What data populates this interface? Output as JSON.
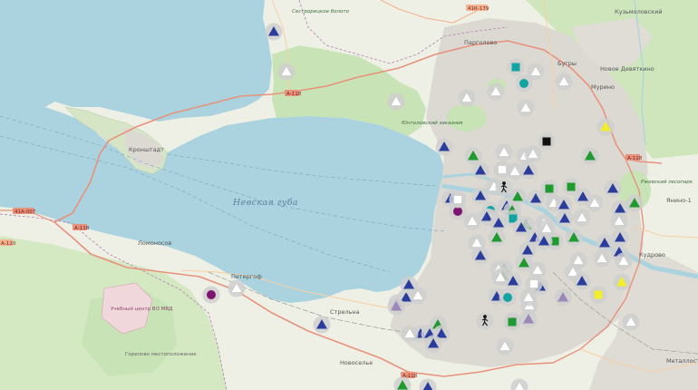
{
  "map": {
    "water_label": "Невская губа",
    "places": [
      {
        "name": "Парголово"
      },
      {
        "name": "Кронштадт"
      },
      {
        "name": "Ломоносов"
      },
      {
        "name": "Петергоф"
      },
      {
        "name": "Стрельна"
      },
      {
        "name": "Новоселье"
      },
      {
        "name": "Кудрово"
      },
      {
        "name": "Мурино"
      },
      {
        "name": "Новое Девяткино"
      },
      {
        "name": "Кузьмоловский"
      },
      {
        "name": "Янино-1"
      },
      {
        "name": "Металлострой"
      },
      {
        "name": "Бугры"
      }
    ],
    "parks": [
      {
        "name": "Юнтоловский заказник"
      },
      {
        "name": "Сестрорецкое болото"
      },
      {
        "name": "Ржевский лесопарк"
      }
    ],
    "roads": [
      {
        "name": "А-118"
      },
      {
        "name": "А-118"
      },
      {
        "name": "А-118"
      },
      {
        "name": "А-118"
      },
      {
        "name": "41К-179"
      },
      {
        "name": "41А-007"
      },
      {
        "name": "А-120"
      }
    ],
    "military": [
      {
        "name": "Учебный центр ВО МВД"
      }
    ],
    "cemeteries": [
      {
        "name": "Горелово местоположение"
      }
    ],
    "colors": {
      "sea": "#aad3df",
      "land": "#eef0e6",
      "forest": "#c8e3b5",
      "urban": "#dfdcd6",
      "road": "#e8927c",
      "marker_gray": "#cfcfcf",
      "blue": "#2a3d9c",
      "green": "#1f9a2e",
      "white": "#ffffff",
      "teal": "#12a3a3",
      "purple": "#7d1570",
      "lavender": "#9b87b8",
      "yellow": "#f2ee2a",
      "black": "#111111"
    }
  },
  "markers": [
    {
      "shape": "triangle",
      "color": "blue"
    },
    {
      "shape": "triangle",
      "color": "white"
    },
    {
      "shape": "square",
      "color": "teal"
    },
    {
      "shape": "triangle",
      "color": "white"
    },
    {
      "shape": "circle",
      "color": "teal"
    },
    {
      "shape": "triangle",
      "color": "white"
    },
    {
      "shape": "triangle",
      "color": "white"
    },
    {
      "shape": "triangle",
      "color": "white"
    },
    {
      "shape": "triangle",
      "color": "white"
    },
    {
      "shape": "triangle",
      "color": "white"
    },
    {
      "shape": "triangle",
      "color": "yellow"
    },
    {
      "shape": "square",
      "color": "black"
    },
    {
      "shape": "triangle",
      "color": "blue"
    },
    {
      "shape": "triangle",
      "color": "green"
    },
    {
      "shape": "triangle",
      "color": "white"
    },
    {
      "shape": "triangle",
      "color": "white"
    },
    {
      "shape": "triangle",
      "color": "white"
    },
    {
      "shape": "triangle",
      "color": "green"
    },
    {
      "shape": "square",
      "color": "white"
    },
    {
      "shape": "triangle",
      "color": "blue"
    },
    {
      "shape": "triangle",
      "color": "white"
    },
    {
      "shape": "triangle",
      "color": "blue"
    },
    {
      "shape": "triangle",
      "color": "white"
    },
    {
      "shape": "square",
      "color": "green"
    },
    {
      "shape": "triangle",
      "color": "blue"
    },
    {
      "shape": "triangle",
      "color": "blue"
    },
    {
      "shape": "circle",
      "color": "teal"
    },
    {
      "shape": "circle",
      "color": "purple"
    },
    {
      "shape": "triangle",
      "color": "green"
    },
    {
      "shape": "triangle",
      "color": "blue"
    },
    {
      "shape": "triangle",
      "color": "white"
    },
    {
      "shape": "triangle",
      "color": "blue"
    },
    {
      "shape": "triangle",
      "color": "white"
    },
    {
      "shape": "triangle",
      "color": "green"
    },
    {
      "shape": "triangle",
      "color": "blue"
    },
    {
      "shape": "triangle",
      "color": "blue"
    },
    {
      "shape": "square",
      "color": "green"
    },
    {
      "shape": "triangle",
      "color": "blue"
    },
    {
      "shape": "square",
      "color": "white"
    },
    {
      "shape": "triangle",
      "color": "white"
    },
    {
      "shape": "triangle",
      "color": "green"
    },
    {
      "shape": "triangle",
      "color": "blue"
    },
    {
      "shape": "triangle",
      "color": "white"
    },
    {
      "shape": "triangle",
      "color": "blue"
    },
    {
      "shape": "triangle",
      "color": "green"
    },
    {
      "shape": "triangle",
      "color": "white"
    },
    {
      "shape": "triangle",
      "color": "blue"
    },
    {
      "shape": "triangle",
      "color": "white"
    },
    {
      "shape": "square",
      "color": "teal"
    },
    {
      "shape": "triangle",
      "color": "green"
    },
    {
      "shape": "triangle",
      "color": "blue"
    },
    {
      "shape": "triangle",
      "color": "white"
    },
    {
      "shape": "triangle",
      "color": "blue"
    },
    {
      "shape": "triangle",
      "color": "green"
    },
    {
      "shape": "triangle",
      "color": "blue"
    },
    {
      "shape": "triangle",
      "color": "white"
    },
    {
      "shape": "triangle",
      "color": "blue"
    },
    {
      "shape": "square",
      "color": "green"
    },
    {
      "shape": "triangle",
      "color": "blue"
    },
    {
      "shape": "triangle",
      "color": "blue"
    },
    {
      "shape": "triangle",
      "color": "white"
    },
    {
      "shape": "triangle",
      "color": "blue"
    },
    {
      "shape": "triangle",
      "color": "blue"
    },
    {
      "shape": "triangle",
      "color": "white"
    },
    {
      "shape": "triangle",
      "color": "white"
    },
    {
      "shape": "triangle",
      "color": "white"
    },
    {
      "shape": "triangle",
      "color": "green"
    },
    {
      "shape": "triangle",
      "color": "white"
    },
    {
      "shape": "triangle",
      "color": "blue"
    },
    {
      "shape": "triangle",
      "color": "lavender"
    },
    {
      "shape": "triangle",
      "color": "white"
    },
    {
      "shape": "square",
      "color": "yellow"
    },
    {
      "shape": "triangle",
      "color": "yellow"
    },
    {
      "shape": "triangle",
      "color": "blue"
    },
    {
      "shape": "triangle",
      "color": "blue"
    },
    {
      "shape": "triangle",
      "color": "blue"
    },
    {
      "shape": "square",
      "color": "white"
    },
    {
      "shape": "triangle",
      "color": "lavender"
    },
    {
      "shape": "triangle",
      "color": "blue"
    },
    {
      "shape": "triangle",
      "color": "white"
    },
    {
      "shape": "triangle",
      "color": "blue"
    },
    {
      "shape": "triangle",
      "color": "lavender"
    },
    {
      "shape": "triangle",
      "color": "lavender"
    },
    {
      "shape": "triangle",
      "color": "white"
    },
    {
      "shape": "square",
      "color": "green"
    },
    {
      "shape": "triangle",
      "color": "blue"
    },
    {
      "shape": "triangle",
      "color": "blue"
    },
    {
      "shape": "circle",
      "color": "teal"
    },
    {
      "shape": "triangle",
      "color": "green"
    },
    {
      "shape": "triangle",
      "color": "green"
    },
    {
      "shape": "triangle",
      "color": "white"
    },
    {
      "shape": "triangle",
      "color": "white"
    },
    {
      "shape": "triangle",
      "color": "blue"
    },
    {
      "shape": "triangle",
      "color": "white"
    },
    {
      "shape": "circle",
      "color": "purple"
    },
    {
      "shape": "triangle",
      "color": "white"
    },
    {
      "shape": "triangle",
      "color": "blue"
    },
    {
      "shape": "triangle",
      "color": "lavender"
    },
    {
      "shape": "triangle",
      "color": "green"
    },
    {
      "shape": "triangle",
      "color": "blue"
    },
    {
      "shape": "triangle",
      "color": "blue"
    },
    {
      "shape": "triangle",
      "color": "white"
    },
    {
      "shape": "triangle",
      "color": "white"
    },
    {
      "shape": "triangle",
      "color": "white"
    },
    {
      "shape": "triangle",
      "color": "green"
    },
    {
      "shape": "triangle",
      "color": "blue"
    },
    {
      "shape": "triangle",
      "color": "white"
    },
    {
      "shape": "walker",
      "color": "black"
    },
    {
      "shape": "walker",
      "color": "black"
    }
  ]
}
